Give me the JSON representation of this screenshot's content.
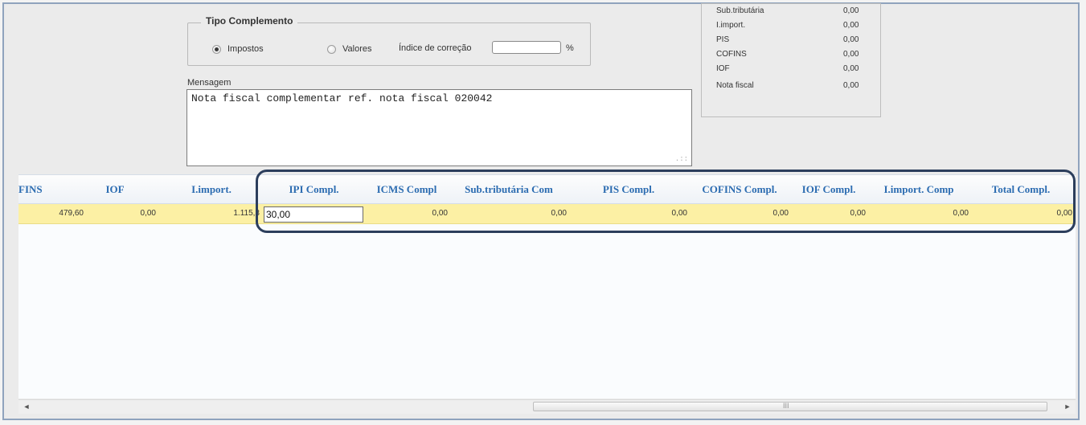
{
  "tipo_complemento": {
    "title": "Tipo Complemento",
    "options": [
      "Impostos",
      "Valores"
    ],
    "selected": "Impostos",
    "indice_label": "Índice de correção",
    "indice_value": "",
    "percent_symbol": "%"
  },
  "mensagem": {
    "label": "Mensagem",
    "text": "Nota fiscal complementar ref. nota fiscal 020042",
    "resize_grip": ".::"
  },
  "summary": [
    {
      "label": "Sub.tributária",
      "value": "0,00"
    },
    {
      "label": "I.import.",
      "value": "0,00"
    },
    {
      "label": "PIS",
      "value": "0,00"
    },
    {
      "label": "COFINS",
      "value": "0,00"
    },
    {
      "label": "IOF",
      "value": "0,00"
    },
    {
      "label": "Nota fiscal",
      "value": "0,00"
    }
  ],
  "grid": {
    "headers": [
      "FINS",
      "IOF",
      "I.import.",
      "IPI Compl.",
      "ICMS Compl",
      "Sub.tributária Com",
      "PIS Compl.",
      "COFINS Compl.",
      "IOF Compl.",
      "I.import. Comp",
      "Total Compl."
    ],
    "row": [
      "479,60",
      "0,00",
      "1.115,3",
      "30,00",
      "0,00",
      "0,00",
      "0,00",
      "0,00",
      "0,00",
      "0,00",
      "0,00"
    ]
  },
  "scrollbar": {
    "left_arrow": "◄",
    "right_arrow": "►",
    "thumb_grip": "III"
  },
  "colors": {
    "header_text": "#2c6cb1",
    "row_highlight": "#fcf0a4",
    "callout_border": "#2c3e5c"
  }
}
